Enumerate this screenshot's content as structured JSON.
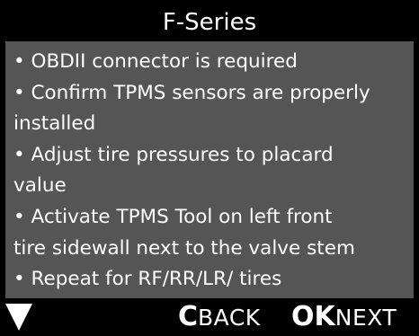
{
  "header": {
    "title": "F-Series"
  },
  "content": {
    "lines": [
      "• OBDII connector is required",
      "• Confirm TPMS sensors are properly",
      "installed",
      "• Adjust tire pressures to placard",
      "value",
      "• Activate TPMS Tool on left front",
      "tire sidewall next to the valve stem",
      "• Repeat for RF/RR/LR/ tires"
    ]
  },
  "footer": {
    "down_icon": "down-triangle-icon",
    "back_key": "C",
    "back_label": "BACK",
    "next_key": "OK",
    "next_label": "NEXT"
  },
  "colors": {
    "background": "#000000",
    "content_background": "#555555",
    "text": "#ffffff"
  }
}
